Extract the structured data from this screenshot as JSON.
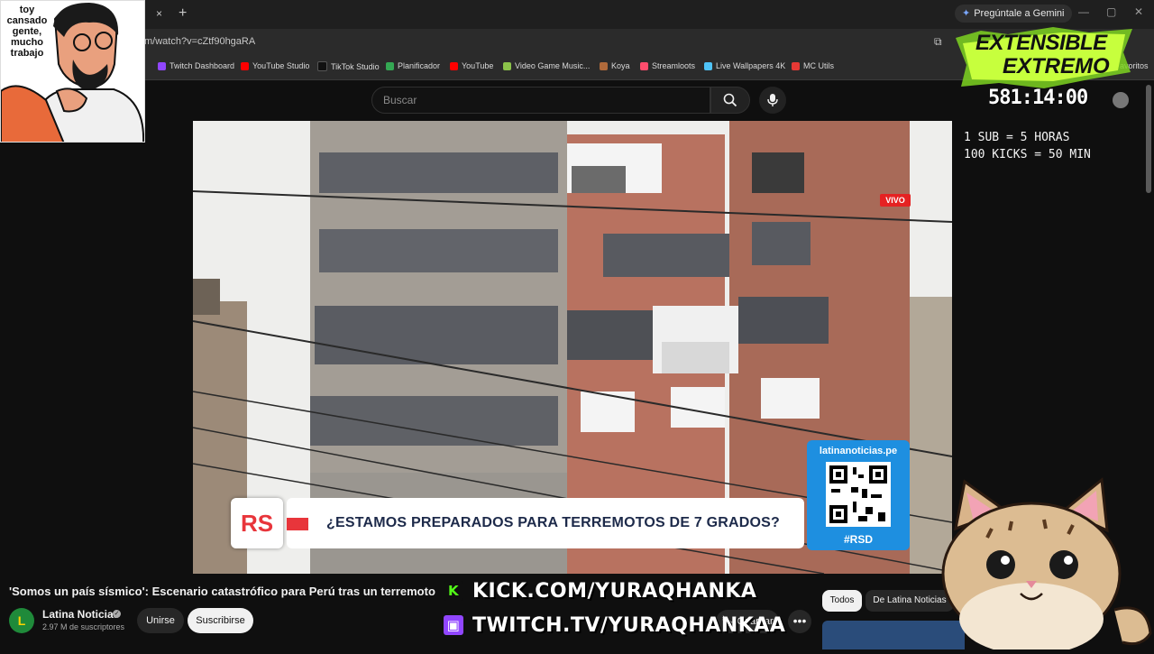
{
  "browser": {
    "tab_close": "×",
    "new_tab": "+",
    "gemini_button": "Pregúntale a Gemini",
    "url": "m/watch?v=cZtf90hgaRA",
    "bookmarks": [
      {
        "label": "Twitch Dashboard",
        "color": "#9146ff"
      },
      {
        "label": "YouTube Studio",
        "color": "#ff0000"
      },
      {
        "label": "TikTok Studio",
        "color": "#111111"
      },
      {
        "label": "Planificador",
        "color": "#34a853"
      },
      {
        "label": "YouTube",
        "color": "#ff0000"
      },
      {
        "label": "Video Game Music...",
        "color": "#8bc34a"
      },
      {
        "label": "Koya",
        "color": "#b06a3b"
      },
      {
        "label": "Streamloots",
        "color": "#ff4d6d"
      },
      {
        "label": "Live Wallpapers 4K",
        "color": "#4fc3f7"
      },
      {
        "label": "MC Utils",
        "color": "#e53935"
      }
    ],
    "favorites_tail": "avoritos"
  },
  "youtube": {
    "search_placeholder": "Buscar",
    "live_badge": "VIVO",
    "lower_third_headline": "¿ESTAMOS PREPARADOS PARA TERREMOTOS DE 7 GRADOS?",
    "lower_third_logo": "RS",
    "qr_url": "latinanoticias.pe",
    "qr_tag": "#RSD",
    "video_title": "'Somos un país sísmico': Escenario catastrófico para Perú tras un terremoto",
    "channel": {
      "avatar_letter": "L",
      "name": "Latina Noticias",
      "subscribers": "2.97 M de suscriptores"
    },
    "join_button": "Unirse",
    "subscribe_button": "Suscribirse",
    "save_button": "Guardar",
    "more_button": "•••",
    "chips": [
      "Todos",
      "De Latina Noticias"
    ]
  },
  "overlay": {
    "webcam_caption": "toy cansado gente, mucho trabajo",
    "brand_line1": "EXTENSIBLE",
    "brand_line2": "EXTREMO",
    "countdown": "581:14:00",
    "rule1": "1 SUB = 5 HORAS",
    "rule2": "100 KICKS = 50 MIN",
    "kick_handle": "KICK.COM/YURAQHANKA",
    "twitch_handle": "TWITCH.TV/YURAQHANKAA"
  },
  "colors": {
    "kick": "#53fc18",
    "twitch": "#9146ff",
    "live": "#e52222",
    "brand": "#b5ff2a"
  }
}
